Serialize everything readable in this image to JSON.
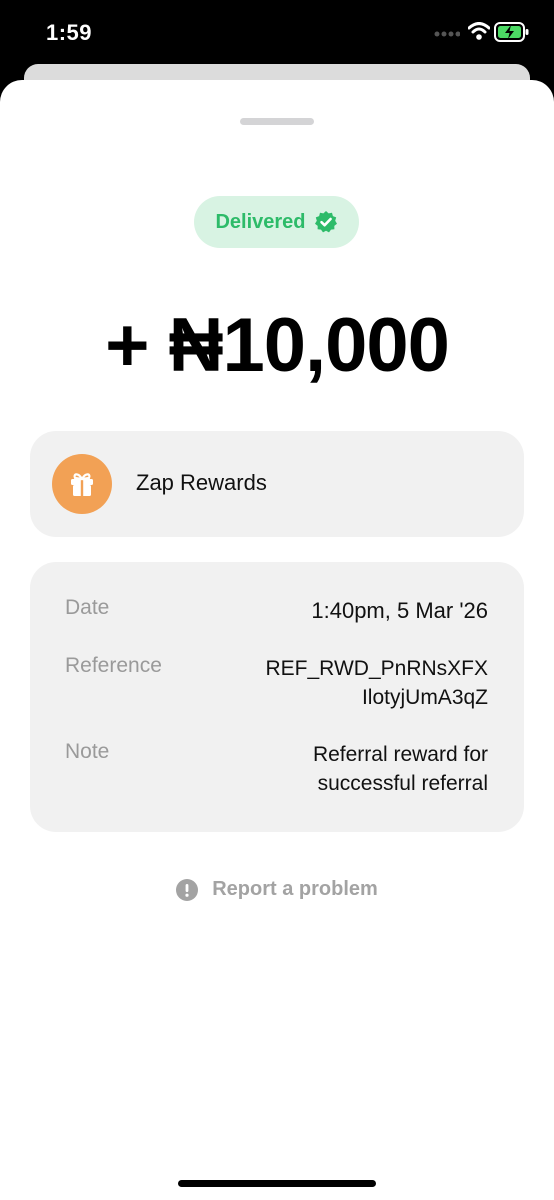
{
  "status_bar": {
    "time": "1:59"
  },
  "transaction": {
    "status": "Delivered",
    "amount": "+ ₦10,000"
  },
  "merchant": {
    "name": "Zap Rewards",
    "icon": "gift-icon"
  },
  "details": [
    {
      "label": "Date",
      "value": "1:40pm, 5 Mar '26"
    },
    {
      "label": "Reference",
      "value_lines": [
        "REF_RWD_PnRNsXFX",
        "IlotyjUmA3qZ"
      ]
    },
    {
      "label": "Note",
      "value_lines": [
        "Referral reward for",
        "successful referral"
      ]
    }
  ],
  "report": {
    "label": "Report a problem"
  },
  "colors": {
    "success": "#2dbb69",
    "success_bg": "#d8f3e3",
    "merchant_avatar": "#f2a155",
    "card_bg": "#f1f1f1"
  }
}
